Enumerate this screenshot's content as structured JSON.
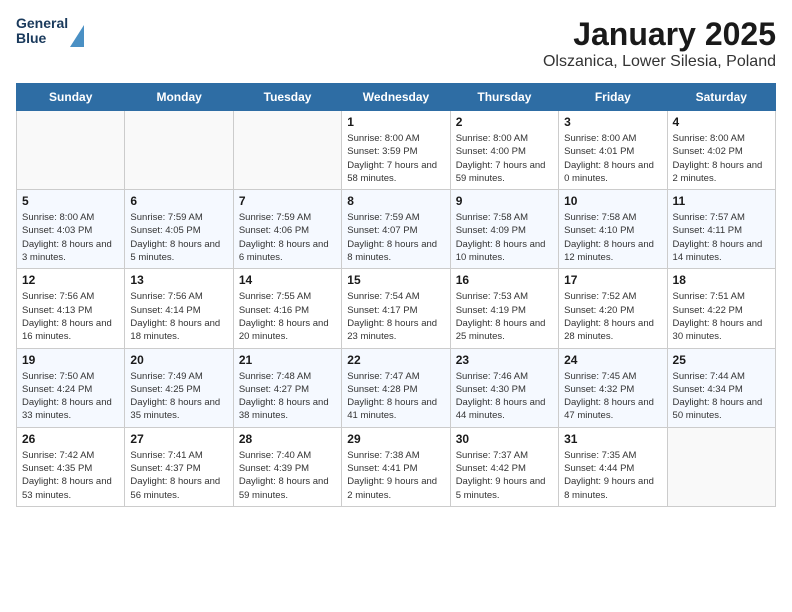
{
  "header": {
    "logo_line1": "General",
    "logo_line2": "Blue",
    "title": "January 2025",
    "subtitle": "Olszanica, Lower Silesia, Poland"
  },
  "weekdays": [
    "Sunday",
    "Monday",
    "Tuesday",
    "Wednesday",
    "Thursday",
    "Friday",
    "Saturday"
  ],
  "weeks": [
    [
      {
        "day": "",
        "info": ""
      },
      {
        "day": "",
        "info": ""
      },
      {
        "day": "",
        "info": ""
      },
      {
        "day": "1",
        "info": "Sunrise: 8:00 AM\nSunset: 3:59 PM\nDaylight: 7 hours and 58 minutes."
      },
      {
        "day": "2",
        "info": "Sunrise: 8:00 AM\nSunset: 4:00 PM\nDaylight: 7 hours and 59 minutes."
      },
      {
        "day": "3",
        "info": "Sunrise: 8:00 AM\nSunset: 4:01 PM\nDaylight: 8 hours and 0 minutes."
      },
      {
        "day": "4",
        "info": "Sunrise: 8:00 AM\nSunset: 4:02 PM\nDaylight: 8 hours and 2 minutes."
      }
    ],
    [
      {
        "day": "5",
        "info": "Sunrise: 8:00 AM\nSunset: 4:03 PM\nDaylight: 8 hours and 3 minutes."
      },
      {
        "day": "6",
        "info": "Sunrise: 7:59 AM\nSunset: 4:05 PM\nDaylight: 8 hours and 5 minutes."
      },
      {
        "day": "7",
        "info": "Sunrise: 7:59 AM\nSunset: 4:06 PM\nDaylight: 8 hours and 6 minutes."
      },
      {
        "day": "8",
        "info": "Sunrise: 7:59 AM\nSunset: 4:07 PM\nDaylight: 8 hours and 8 minutes."
      },
      {
        "day": "9",
        "info": "Sunrise: 7:58 AM\nSunset: 4:09 PM\nDaylight: 8 hours and 10 minutes."
      },
      {
        "day": "10",
        "info": "Sunrise: 7:58 AM\nSunset: 4:10 PM\nDaylight: 8 hours and 12 minutes."
      },
      {
        "day": "11",
        "info": "Sunrise: 7:57 AM\nSunset: 4:11 PM\nDaylight: 8 hours and 14 minutes."
      }
    ],
    [
      {
        "day": "12",
        "info": "Sunrise: 7:56 AM\nSunset: 4:13 PM\nDaylight: 8 hours and 16 minutes."
      },
      {
        "day": "13",
        "info": "Sunrise: 7:56 AM\nSunset: 4:14 PM\nDaylight: 8 hours and 18 minutes."
      },
      {
        "day": "14",
        "info": "Sunrise: 7:55 AM\nSunset: 4:16 PM\nDaylight: 8 hours and 20 minutes."
      },
      {
        "day": "15",
        "info": "Sunrise: 7:54 AM\nSunset: 4:17 PM\nDaylight: 8 hours and 23 minutes."
      },
      {
        "day": "16",
        "info": "Sunrise: 7:53 AM\nSunset: 4:19 PM\nDaylight: 8 hours and 25 minutes."
      },
      {
        "day": "17",
        "info": "Sunrise: 7:52 AM\nSunset: 4:20 PM\nDaylight: 8 hours and 28 minutes."
      },
      {
        "day": "18",
        "info": "Sunrise: 7:51 AM\nSunset: 4:22 PM\nDaylight: 8 hours and 30 minutes."
      }
    ],
    [
      {
        "day": "19",
        "info": "Sunrise: 7:50 AM\nSunset: 4:24 PM\nDaylight: 8 hours and 33 minutes."
      },
      {
        "day": "20",
        "info": "Sunrise: 7:49 AM\nSunset: 4:25 PM\nDaylight: 8 hours and 35 minutes."
      },
      {
        "day": "21",
        "info": "Sunrise: 7:48 AM\nSunset: 4:27 PM\nDaylight: 8 hours and 38 minutes."
      },
      {
        "day": "22",
        "info": "Sunrise: 7:47 AM\nSunset: 4:28 PM\nDaylight: 8 hours and 41 minutes."
      },
      {
        "day": "23",
        "info": "Sunrise: 7:46 AM\nSunset: 4:30 PM\nDaylight: 8 hours and 44 minutes."
      },
      {
        "day": "24",
        "info": "Sunrise: 7:45 AM\nSunset: 4:32 PM\nDaylight: 8 hours and 47 minutes."
      },
      {
        "day": "25",
        "info": "Sunrise: 7:44 AM\nSunset: 4:34 PM\nDaylight: 8 hours and 50 minutes."
      }
    ],
    [
      {
        "day": "26",
        "info": "Sunrise: 7:42 AM\nSunset: 4:35 PM\nDaylight: 8 hours and 53 minutes."
      },
      {
        "day": "27",
        "info": "Sunrise: 7:41 AM\nSunset: 4:37 PM\nDaylight: 8 hours and 56 minutes."
      },
      {
        "day": "28",
        "info": "Sunrise: 7:40 AM\nSunset: 4:39 PM\nDaylight: 8 hours and 59 minutes."
      },
      {
        "day": "29",
        "info": "Sunrise: 7:38 AM\nSunset: 4:41 PM\nDaylight: 9 hours and 2 minutes."
      },
      {
        "day": "30",
        "info": "Sunrise: 7:37 AM\nSunset: 4:42 PM\nDaylight: 9 hours and 5 minutes."
      },
      {
        "day": "31",
        "info": "Sunrise: 7:35 AM\nSunset: 4:44 PM\nDaylight: 9 hours and 8 minutes."
      },
      {
        "day": "",
        "info": ""
      }
    ]
  ]
}
